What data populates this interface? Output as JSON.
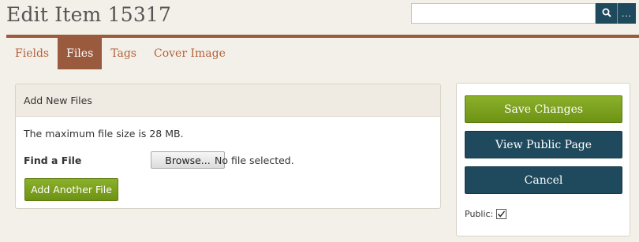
{
  "header": {
    "title": "Edit Item 15317",
    "search_value": "",
    "search_icon": "search-icon",
    "advanced_label": "..."
  },
  "tabs": [
    {
      "label": "Fields",
      "active": false
    },
    {
      "label": "Files",
      "active": true
    },
    {
      "label": "Tags",
      "active": false
    },
    {
      "label": "Cover Image",
      "active": false
    }
  ],
  "files_panel": {
    "heading": "Add New Files",
    "max_size_text": "The maximum file size is 28 MB.",
    "find_label": "Find a File",
    "browse_label": "Browse...",
    "no_file_text": "No file selected.",
    "add_another_label": "Add Another File"
  },
  "sidebar": {
    "save_label": "Save Changes",
    "view_label": "View Public Page",
    "cancel_label": "Cancel",
    "public_label": "Public:",
    "public_checked": true
  },
  "colors": {
    "accent_brown": "#9a5a3e",
    "tab_text": "#b5613b",
    "green": "#7aa01d",
    "navy": "#1f4a5e"
  }
}
